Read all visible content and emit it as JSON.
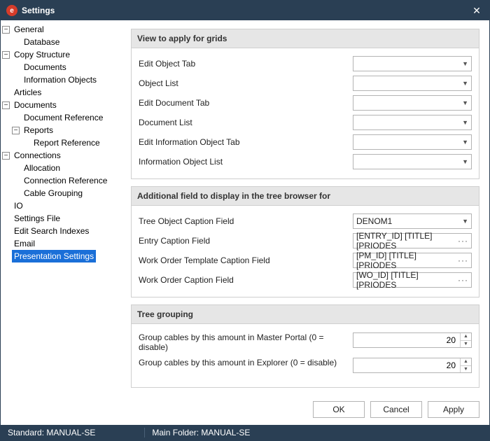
{
  "window": {
    "title": "Settings"
  },
  "tree": {
    "general": "General",
    "database": "Database",
    "copy_structure": "Copy Structure",
    "cs_documents": "Documents",
    "cs_info_objects": "Information Objects",
    "articles": "Articles",
    "documents": "Documents",
    "document_reference": "Document Reference",
    "reports": "Reports",
    "report_reference": "Report Reference",
    "connections": "Connections",
    "allocation": "Allocation",
    "connection_reference": "Connection Reference",
    "cable_grouping": "Cable Grouping",
    "io": "IO",
    "settings_file": "Settings File",
    "edit_search_indexes": "Edit Search Indexes",
    "email": "Email",
    "presentation_settings": "Presentation Settings"
  },
  "sections": {
    "view_grids": {
      "header": "View to apply for grids",
      "fields": {
        "edit_object_tab": {
          "label": "Edit Object Tab",
          "value": ""
        },
        "object_list": {
          "label": "Object List",
          "value": ""
        },
        "edit_document_tab": {
          "label": "Edit Document Tab",
          "value": ""
        },
        "document_list": {
          "label": "Document List",
          "value": ""
        },
        "edit_info_tab": {
          "label": "Edit Information Object Tab",
          "value": ""
        },
        "info_list": {
          "label": "Information Object List",
          "value": ""
        }
      }
    },
    "additional_field": {
      "header": "Additional field to display in the tree browser for",
      "fields": {
        "tree_object_caption": {
          "label": "Tree Object Caption Field",
          "value": "DENOM1"
        },
        "entry_caption": {
          "label": "Entry Caption Field",
          "value": "[ENTRY_ID] [TITLE] [PRIODES"
        },
        "wo_template_caption": {
          "label": "Work Order Template Caption Field",
          "value": "[PM_ID] [TITLE] [PRIODES"
        },
        "wo_caption": {
          "label": "Work Order Caption Field",
          "value": "[WO_ID] [TITLE] [PRIODES"
        }
      }
    },
    "tree_grouping": {
      "header": "Tree grouping",
      "fields": {
        "master_portal": {
          "label": "Group cables by this amount in Master Portal (0 = disable)",
          "value": 20
        },
        "explorer": {
          "label": "Group cables by this amount in Explorer (0 = disable)",
          "value": 20
        }
      }
    }
  },
  "buttons": {
    "ok": "OK",
    "cancel": "Cancel",
    "apply": "Apply"
  },
  "status": {
    "standard": "Standard: MANUAL-SE",
    "main_folder": "Main Folder: MANUAL-SE"
  }
}
